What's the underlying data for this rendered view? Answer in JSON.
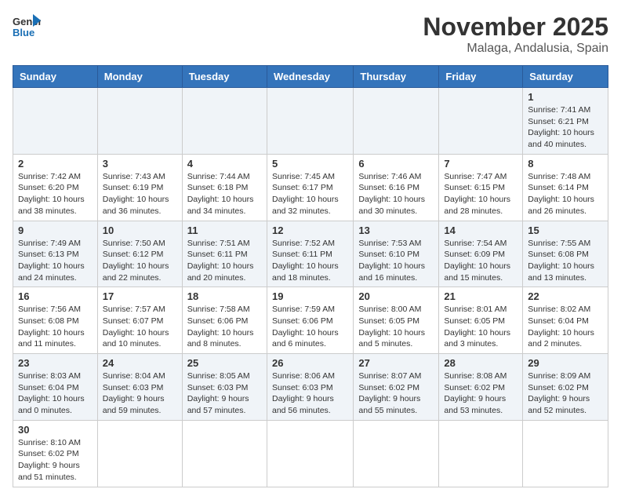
{
  "header": {
    "logo_general": "General",
    "logo_blue": "Blue",
    "month": "November 2025",
    "location": "Malaga, Andalusia, Spain"
  },
  "weekdays": [
    "Sunday",
    "Monday",
    "Tuesday",
    "Wednesday",
    "Thursday",
    "Friday",
    "Saturday"
  ],
  "weeks": [
    [
      {
        "day": "",
        "info": ""
      },
      {
        "day": "",
        "info": ""
      },
      {
        "day": "",
        "info": ""
      },
      {
        "day": "",
        "info": ""
      },
      {
        "day": "",
        "info": ""
      },
      {
        "day": "",
        "info": ""
      },
      {
        "day": "1",
        "info": "Sunrise: 7:41 AM\nSunset: 6:21 PM\nDaylight: 10 hours and 40 minutes."
      }
    ],
    [
      {
        "day": "2",
        "info": "Sunrise: 7:42 AM\nSunset: 6:20 PM\nDaylight: 10 hours and 38 minutes."
      },
      {
        "day": "3",
        "info": "Sunrise: 7:43 AM\nSunset: 6:19 PM\nDaylight: 10 hours and 36 minutes."
      },
      {
        "day": "4",
        "info": "Sunrise: 7:44 AM\nSunset: 6:18 PM\nDaylight: 10 hours and 34 minutes."
      },
      {
        "day": "5",
        "info": "Sunrise: 7:45 AM\nSunset: 6:17 PM\nDaylight: 10 hours and 32 minutes."
      },
      {
        "day": "6",
        "info": "Sunrise: 7:46 AM\nSunset: 6:16 PM\nDaylight: 10 hours and 30 minutes."
      },
      {
        "day": "7",
        "info": "Sunrise: 7:47 AM\nSunset: 6:15 PM\nDaylight: 10 hours and 28 minutes."
      },
      {
        "day": "8",
        "info": "Sunrise: 7:48 AM\nSunset: 6:14 PM\nDaylight: 10 hours and 26 minutes."
      }
    ],
    [
      {
        "day": "9",
        "info": "Sunrise: 7:49 AM\nSunset: 6:13 PM\nDaylight: 10 hours and 24 minutes."
      },
      {
        "day": "10",
        "info": "Sunrise: 7:50 AM\nSunset: 6:12 PM\nDaylight: 10 hours and 22 minutes."
      },
      {
        "day": "11",
        "info": "Sunrise: 7:51 AM\nSunset: 6:11 PM\nDaylight: 10 hours and 20 minutes."
      },
      {
        "day": "12",
        "info": "Sunrise: 7:52 AM\nSunset: 6:11 PM\nDaylight: 10 hours and 18 minutes."
      },
      {
        "day": "13",
        "info": "Sunrise: 7:53 AM\nSunset: 6:10 PM\nDaylight: 10 hours and 16 minutes."
      },
      {
        "day": "14",
        "info": "Sunrise: 7:54 AM\nSunset: 6:09 PM\nDaylight: 10 hours and 15 minutes."
      },
      {
        "day": "15",
        "info": "Sunrise: 7:55 AM\nSunset: 6:08 PM\nDaylight: 10 hours and 13 minutes."
      }
    ],
    [
      {
        "day": "16",
        "info": "Sunrise: 7:56 AM\nSunset: 6:08 PM\nDaylight: 10 hours and 11 minutes."
      },
      {
        "day": "17",
        "info": "Sunrise: 7:57 AM\nSunset: 6:07 PM\nDaylight: 10 hours and 10 minutes."
      },
      {
        "day": "18",
        "info": "Sunrise: 7:58 AM\nSunset: 6:06 PM\nDaylight: 10 hours and 8 minutes."
      },
      {
        "day": "19",
        "info": "Sunrise: 7:59 AM\nSunset: 6:06 PM\nDaylight: 10 hours and 6 minutes."
      },
      {
        "day": "20",
        "info": "Sunrise: 8:00 AM\nSunset: 6:05 PM\nDaylight: 10 hours and 5 minutes."
      },
      {
        "day": "21",
        "info": "Sunrise: 8:01 AM\nSunset: 6:05 PM\nDaylight: 10 hours and 3 minutes."
      },
      {
        "day": "22",
        "info": "Sunrise: 8:02 AM\nSunset: 6:04 PM\nDaylight: 10 hours and 2 minutes."
      }
    ],
    [
      {
        "day": "23",
        "info": "Sunrise: 8:03 AM\nSunset: 6:04 PM\nDaylight: 10 hours and 0 minutes."
      },
      {
        "day": "24",
        "info": "Sunrise: 8:04 AM\nSunset: 6:03 PM\nDaylight: 9 hours and 59 minutes."
      },
      {
        "day": "25",
        "info": "Sunrise: 8:05 AM\nSunset: 6:03 PM\nDaylight: 9 hours and 57 minutes."
      },
      {
        "day": "26",
        "info": "Sunrise: 8:06 AM\nSunset: 6:03 PM\nDaylight: 9 hours and 56 minutes."
      },
      {
        "day": "27",
        "info": "Sunrise: 8:07 AM\nSunset: 6:02 PM\nDaylight: 9 hours and 55 minutes."
      },
      {
        "day": "28",
        "info": "Sunrise: 8:08 AM\nSunset: 6:02 PM\nDaylight: 9 hours and 53 minutes."
      },
      {
        "day": "29",
        "info": "Sunrise: 8:09 AM\nSunset: 6:02 PM\nDaylight: 9 hours and 52 minutes."
      }
    ],
    [
      {
        "day": "30",
        "info": "Sunrise: 8:10 AM\nSunset: 6:02 PM\nDaylight: 9 hours and 51 minutes."
      },
      {
        "day": "",
        "info": ""
      },
      {
        "day": "",
        "info": ""
      },
      {
        "day": "",
        "info": ""
      },
      {
        "day": "",
        "info": ""
      },
      {
        "day": "",
        "info": ""
      },
      {
        "day": "",
        "info": ""
      }
    ]
  ]
}
